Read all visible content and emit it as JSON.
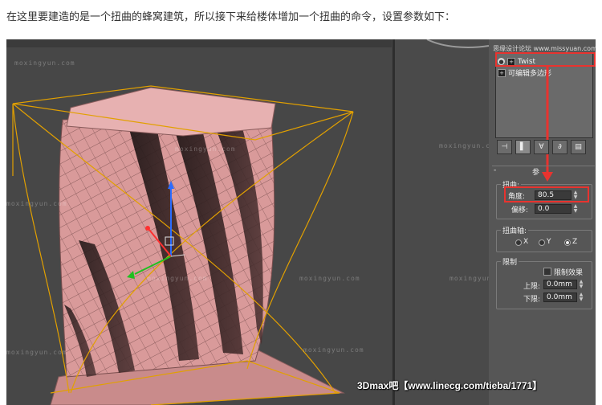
{
  "caption": "在这里要建造的是一个扭曲的蜂窝建筑，所以接下来给楼体增加一个扭曲的命令，设置参数如下：",
  "watermark": "moxingyun.com",
  "banner": "3Dmax吧【www.linecg.com/tieba/1771】",
  "panel_header_text": "思缘设计论坛 www.missyuan.com",
  "modifier_stack": {
    "items": [
      {
        "label": "Twist",
        "selected": true
      },
      {
        "label": "可编辑多边形",
        "selected": false
      }
    ]
  },
  "toolbar": {
    "pin_glyph": "⊣",
    "show_end_glyph": "▌",
    "unique_glyph": "∀",
    "remove_glyph": "∂",
    "config_glyph": "▤"
  },
  "params": {
    "rollout_minus": "-",
    "rollout_title": "参",
    "twist_group": "扭曲:",
    "angle_label": "角度:",
    "angle_value": "80.5",
    "bias_label": "偏移:",
    "bias_value": "0.0",
    "axis_group": "扭曲轴:",
    "axis_options": [
      "X",
      "Y",
      "Z"
    ],
    "axis_selected": "Z",
    "limits_group": "限制",
    "limit_effect_label": "限制效果",
    "upper_label": "上限:",
    "upper_value": "0.0mm",
    "lower_label": "下限:",
    "lower_value": "0.0mm"
  },
  "colors": {
    "accent_red": "#e8332f",
    "mesh_pink": "#e3a3a3",
    "bbox_orange": "#e2a000"
  }
}
